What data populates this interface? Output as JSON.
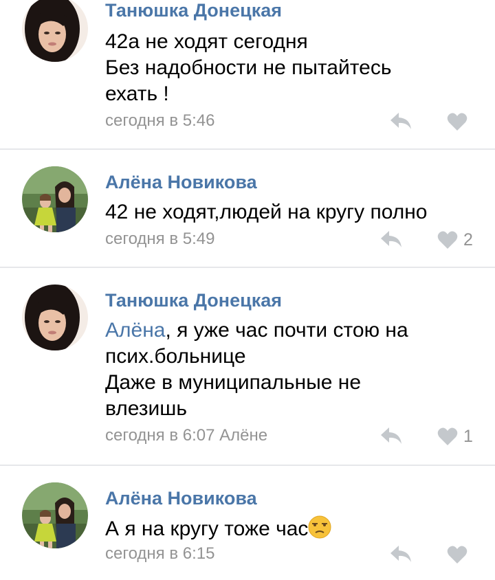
{
  "comments": [
    {
      "author": "Танюшка Донецкая",
      "lines": [
        "42а не ходят сегодня",
        "Без надобности не пытайтесь",
        "ехать !"
      ],
      "time": "сегодня в 5:46",
      "likes": ""
    },
    {
      "author": "Алёна Новикова",
      "lines": [
        "42 не ходят,людей на кругу полно"
      ],
      "time": "сегодня в 5:49",
      "likes": "2"
    },
    {
      "author": "Танюшка Донецкая",
      "mention": "Алёна",
      "mention_rest": ", я уже час почти стою на",
      "lines": [
        "псих.больнице",
        "Даже в муниципальные не",
        "влезишь"
      ],
      "time": "сегодня в 6:07 Алёне",
      "likes": "1"
    },
    {
      "author": "Алёна Новикова",
      "lines": [
        "А я на кругу тоже час"
      ],
      "time": "сегодня в 6:15",
      "likes": ""
    }
  ],
  "icons": {
    "reply": "reply-arrow-icon",
    "like": "heart-icon",
    "emoji": "unamused-face-emoji-icon"
  },
  "colors": {
    "author": "#4a76a8",
    "meta": "#939393",
    "divider": "#e6e7ea",
    "icon": "#c4c8cc"
  }
}
